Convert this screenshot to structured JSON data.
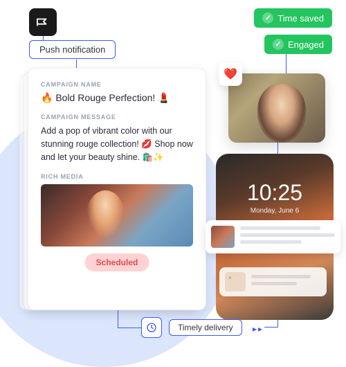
{
  "labels": {
    "push_notification": "Push notification",
    "timely_delivery": "Timely delivery"
  },
  "benefits": {
    "time_saved": "Time saved",
    "engaged": "Engaged"
  },
  "campaign": {
    "name_label": "CAMPAIGN NAME",
    "name": "🔥 Bold Rouge Perfection! 💄",
    "message_label": "CAMPAIGN MESSAGE",
    "message": "Add a pop of vibrant color with our stunning rouge collection! 💋 Shop now and let your beauty shine. 🛍️✨",
    "media_label": "RICH MEDIA",
    "status": "Scheduled"
  },
  "phone": {
    "time": "10:25",
    "date": "Monday, June 6"
  },
  "reaction": {
    "heart": "❤️"
  }
}
